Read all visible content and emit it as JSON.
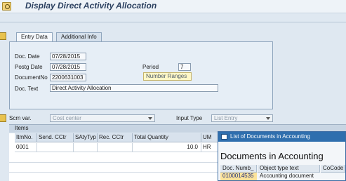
{
  "window": {
    "title": "Display Direct Activity Allocation"
  },
  "tabs": [
    {
      "label": "Entry Data",
      "active": true
    },
    {
      "label": "Additional Info",
      "active": false
    }
  ],
  "form": {
    "doc_date_label": "Doc. Date",
    "doc_date": "07/28/2015",
    "postg_date_label": "Postg Date",
    "postg_date": "07/28/2015",
    "document_no_label": "DocumentNo",
    "document_no": "2200631003",
    "doc_text_label": "Doc. Text",
    "doc_text": "Direct Activity Allocation",
    "period_label": "Period",
    "period": "7",
    "tooltip": "Number Ranges"
  },
  "screen_vars": {
    "scrn_var_label": "Scrn var.",
    "scrn_var_value": "Cost center",
    "input_type_label": "Input Type",
    "input_type_value": "List Entry"
  },
  "items": {
    "section_label": "Items",
    "columns": [
      "ItmNo.",
      "Send. CCtr",
      "SAtyTyp",
      "Rec. CCtr",
      "Total Quantity",
      "UM"
    ],
    "rows": [
      {
        "itm_no": "0001",
        "send_cctr": "",
        "satytyp": "",
        "rec_cctr": "",
        "total_quantity": "10.0",
        "um": "HR"
      }
    ]
  },
  "popup": {
    "title": "List of Documents in Accounting",
    "heading": "Documents in Accounting",
    "columns": [
      "Doc. Numb_",
      "Object type text",
      "CoCode"
    ],
    "rows": [
      {
        "doc_number": "0100014535",
        "object_type_text": "Accounting document",
        "cocode": ""
      }
    ]
  },
  "colors": {
    "background": "#dfe8f1",
    "popup_titlebar": "#2f6fae",
    "selection": "#fbe39a",
    "tooltip": "#fff7c6"
  }
}
